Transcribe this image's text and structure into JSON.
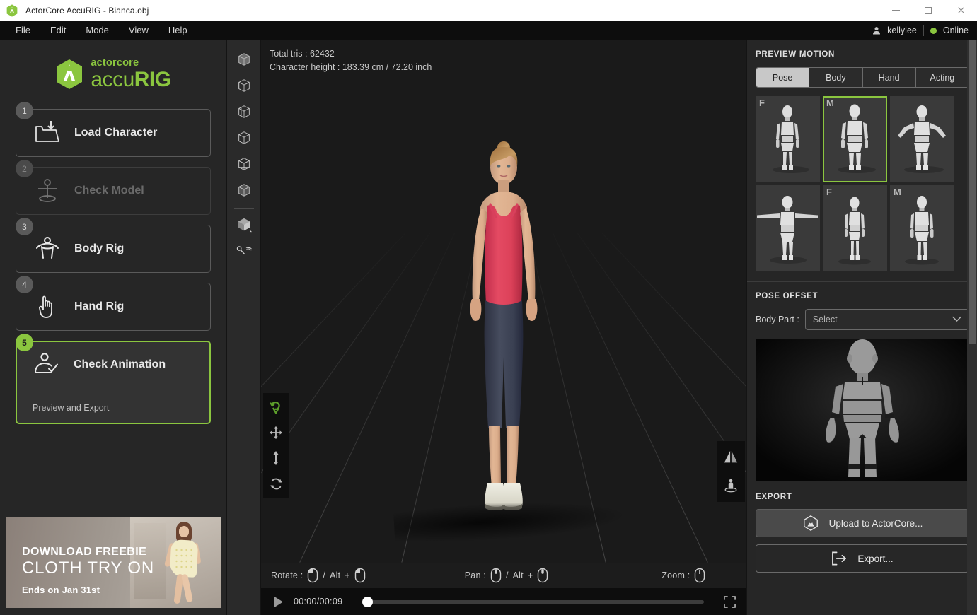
{
  "window": {
    "title": "ActorCore AccuRIG - Bianca.obj",
    "logo_icon": "accurig-logo-icon",
    "minimize_icon": "minimize-icon",
    "maximize_icon": "maximize-icon",
    "close_icon": "close-icon"
  },
  "menubar": {
    "items": [
      {
        "label": "File"
      },
      {
        "label": "Edit"
      },
      {
        "label": "Mode"
      },
      {
        "label": "View"
      },
      {
        "label": "Help"
      }
    ],
    "user": {
      "avatar_icon": "user-icon",
      "name": "kellylee",
      "status": "Online",
      "status_color": "#8bc63f"
    }
  },
  "sidebar": {
    "brand": {
      "top": "actorcore",
      "bottom_light": "accu",
      "bottom_bold": "RIG",
      "color": "#8bc63f",
      "logo_icon": "accurig-hex-logo-icon"
    },
    "steps": [
      {
        "number": "1",
        "label": "Load Character",
        "icon": "load-character-icon",
        "state": "enabled"
      },
      {
        "number": "2",
        "label": "Check Model",
        "icon": "check-model-icon",
        "state": "disabled"
      },
      {
        "number": "3",
        "label": "Body Rig",
        "icon": "body-rig-icon",
        "state": "enabled"
      },
      {
        "number": "4",
        "label": "Hand Rig",
        "icon": "hand-rig-icon",
        "state": "enabled"
      },
      {
        "number": "5",
        "label": "Check Animation",
        "sublabel": "Preview and Export",
        "icon": "check-animation-icon",
        "state": "active"
      }
    ],
    "promo": {
      "line1": "DOWNLOAD FREEBIE",
      "line2": "CLOTH TRY ON",
      "line3": "Ends on Jan 31st"
    }
  },
  "rail": {
    "items": [
      {
        "icon": "view-mode-1-icon"
      },
      {
        "icon": "view-mode-2-icon"
      },
      {
        "icon": "view-mode-3-icon"
      },
      {
        "icon": "view-mode-4-icon"
      },
      {
        "icon": "view-mode-5-icon"
      },
      {
        "icon": "view-mode-6-icon"
      },
      {
        "icon": "solid-cube-icon"
      },
      {
        "icon": "lighting-icon"
      }
    ]
  },
  "viewport": {
    "stats": {
      "total_tris": "Total tris : 62432",
      "character_height": "Character height : 183.39 cm / 72.20 inch"
    },
    "gizmo_tools": [
      {
        "icon": "orbit-tool-icon",
        "active": true,
        "color": "#5d9e2b"
      },
      {
        "icon": "move-tool-icon",
        "active": false
      },
      {
        "icon": "height-tool-icon",
        "active": false
      },
      {
        "icon": "rotate-tool-icon",
        "active": false
      }
    ],
    "side_tools": [
      {
        "icon": "mirror-icon"
      },
      {
        "icon": "ground-character-icon"
      }
    ],
    "nav_hints": [
      {
        "label": "Rotate :",
        "mouse_a": "left-button-mouse-icon",
        "sep": "/",
        "alt": "Alt",
        "plus": "+",
        "mouse_b": "left-button-mouse-icon"
      },
      {
        "label": "Pan :",
        "mouse_a": "middle-button-mouse-icon",
        "sep": "/",
        "alt": "Alt",
        "plus": "+",
        "mouse_b": "middle-button-mouse-icon"
      },
      {
        "label": "Zoom :",
        "mouse_a": "scroll-wheel-mouse-icon",
        "sep": "",
        "alt": "",
        "plus": "",
        "mouse_b": ""
      }
    ],
    "playback": {
      "play_icon": "play-icon",
      "time": "00:00/00:09",
      "progress_percent": 0,
      "fullscreen_icon": "fullscreen-icon"
    }
  },
  "right_panel": {
    "preview_motion": {
      "title": "PREVIEW MOTION",
      "tabs": [
        {
          "label": "Pose",
          "selected": true
        },
        {
          "label": "Body",
          "selected": false
        },
        {
          "label": "Hand",
          "selected": false
        },
        {
          "label": "Acting",
          "selected": false
        }
      ],
      "thumbnails": [
        {
          "badge": "F",
          "selected": false,
          "pose": "relaxed"
        },
        {
          "badge": "M",
          "selected": true,
          "pose": "relaxed"
        },
        {
          "badge": "",
          "selected": false,
          "pose": "arms-out"
        },
        {
          "badge": "",
          "selected": false,
          "pose": "t-pose"
        },
        {
          "badge": "F",
          "selected": false,
          "pose": "attention"
        },
        {
          "badge": "M",
          "selected": false,
          "pose": "attention"
        }
      ]
    },
    "pose_offset": {
      "title": "POSE OFFSET",
      "body_part_label": "Body Part :",
      "body_part_value": "Select",
      "caret_icon": "chevron-down-icon"
    },
    "export": {
      "title": "EXPORT",
      "upload_label": "Upload to ActorCore...",
      "upload_icon": "actorcore-cube-icon",
      "export_label": "Export...",
      "export_icon": "export-arrow-icon"
    }
  },
  "colors": {
    "accent_green": "#8bc63f",
    "panel_bg": "#262626",
    "viewport_bg": "#1a1a1a",
    "titlebar_bg": "#ffffff",
    "menubar_bg": "#0d0d0d"
  }
}
